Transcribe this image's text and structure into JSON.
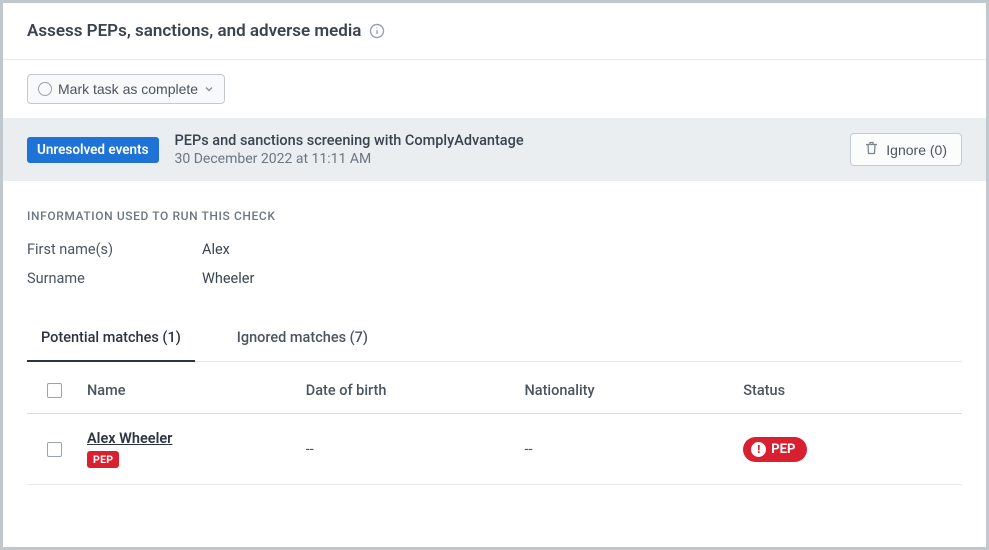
{
  "header": {
    "title": "Assess PEPs, sanctions, and adverse media"
  },
  "toolbar": {
    "mark_complete_label": "Mark task as complete"
  },
  "event": {
    "badge": "Unresolved events",
    "title": "PEPs and sanctions screening with ComplyAdvantage",
    "timestamp": "30 December 2022 at 11:11 AM",
    "ignore_label": "Ignore (0)"
  },
  "info_section": {
    "heading": "INFORMATION USED TO RUN THIS CHECK",
    "first_name_label": "First name(s)",
    "first_name_value": "Alex",
    "surname_label": "Surname",
    "surname_value": "Wheeler"
  },
  "tabs": {
    "potential": "Potential matches (1)",
    "ignored": "Ignored matches (7)"
  },
  "table": {
    "headers": {
      "name": "Name",
      "dob": "Date of birth",
      "nationality": "Nationality",
      "status": "Status"
    },
    "rows": [
      {
        "name": "Alex Wheeler",
        "name_badge": "PEP",
        "dob": "--",
        "nationality": "--",
        "status": "PEP"
      }
    ]
  }
}
